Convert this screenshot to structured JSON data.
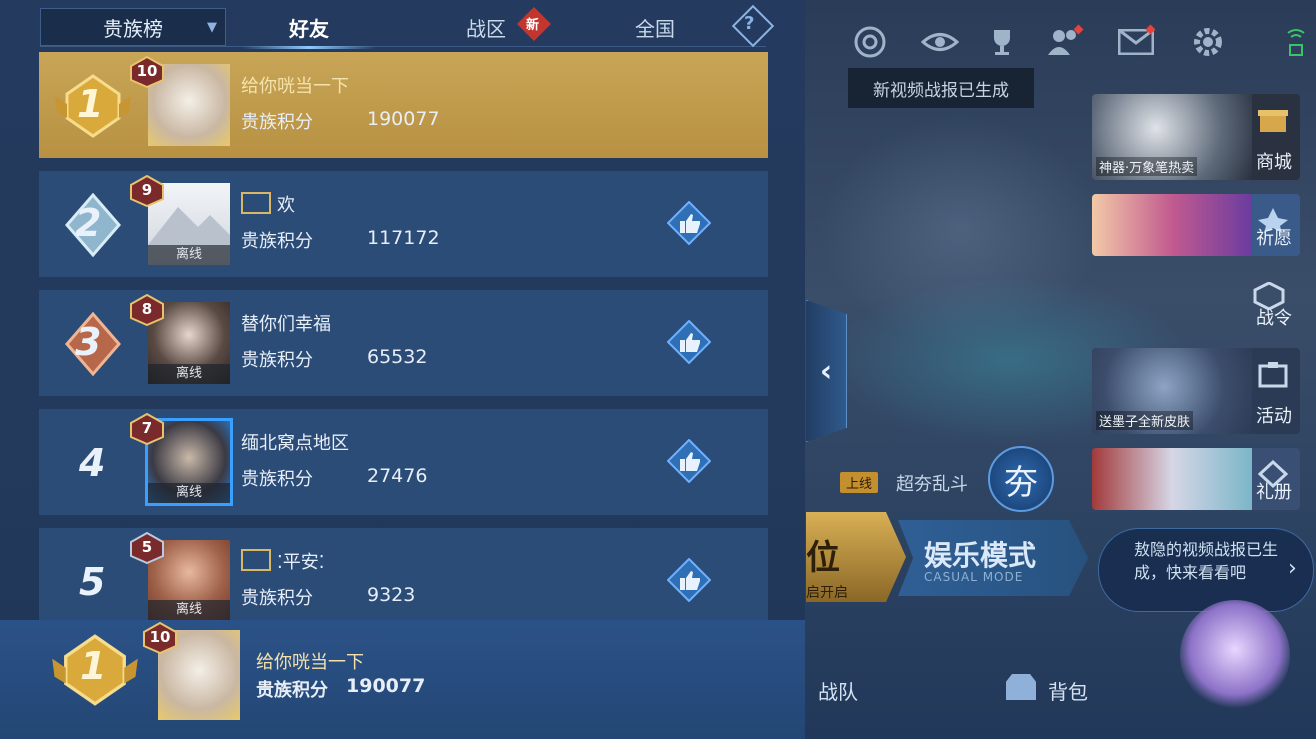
{
  "lobby": {
    "tooltip": "新视频战报已生成",
    "side_buttons": [
      {
        "label": "商城",
        "caption": "神器·万象笔热卖"
      },
      {
        "label": "祈愿",
        "caption": ""
      },
      {
        "label": "战令",
        "caption": ""
      },
      {
        "label": "活动",
        "caption": "送墨子全新皮肤"
      },
      {
        "label": "礼册",
        "caption": ""
      }
    ],
    "online_tag": "上线",
    "brawl_text": "超夯乱斗",
    "kua_glyph": "夯",
    "rank_mode_fragment": "位",
    "rank_mode_sub": "启开启",
    "casual_mode": "娱乐模式",
    "casual_mode_en": "CASUAL MODE",
    "notice": "敖隐的视频战报已生成，快来看看吧",
    "bottom_nav": [
      "战队",
      "背包"
    ]
  },
  "panel": {
    "dropdown": "贵族榜",
    "tabs": {
      "friends": "好友",
      "district": "战区",
      "national": "全国"
    },
    "new_badge": "新",
    "help": "?",
    "score_label": "贵族积分",
    "offline_label": "离线"
  },
  "rows": [
    {
      "rank": "1",
      "level": "10",
      "name": "给你咣当一下",
      "score": "190077",
      "offline": false
    },
    {
      "rank": "2",
      "level": "9",
      "name": "欢",
      "score": "117172",
      "offline": true
    },
    {
      "rank": "3",
      "level": "8",
      "name": "替你们幸福",
      "score": "65532",
      "offline": true
    },
    {
      "rank": "4",
      "level": "7",
      "name": "缅北窝点地区",
      "score": "27476",
      "offline": true
    },
    {
      "rank": "5",
      "level": "5",
      "name": "⁚平安⁚",
      "score": "9323",
      "offline": true
    }
  ],
  "self": {
    "rank": "1",
    "level": "10",
    "name": "给你咣当一下",
    "score": "190077"
  },
  "colors": {
    "panel": "#233a5c",
    "row": "#2c4c78",
    "gold_row": "#c8a557",
    "accent": "#8ec8ff"
  }
}
